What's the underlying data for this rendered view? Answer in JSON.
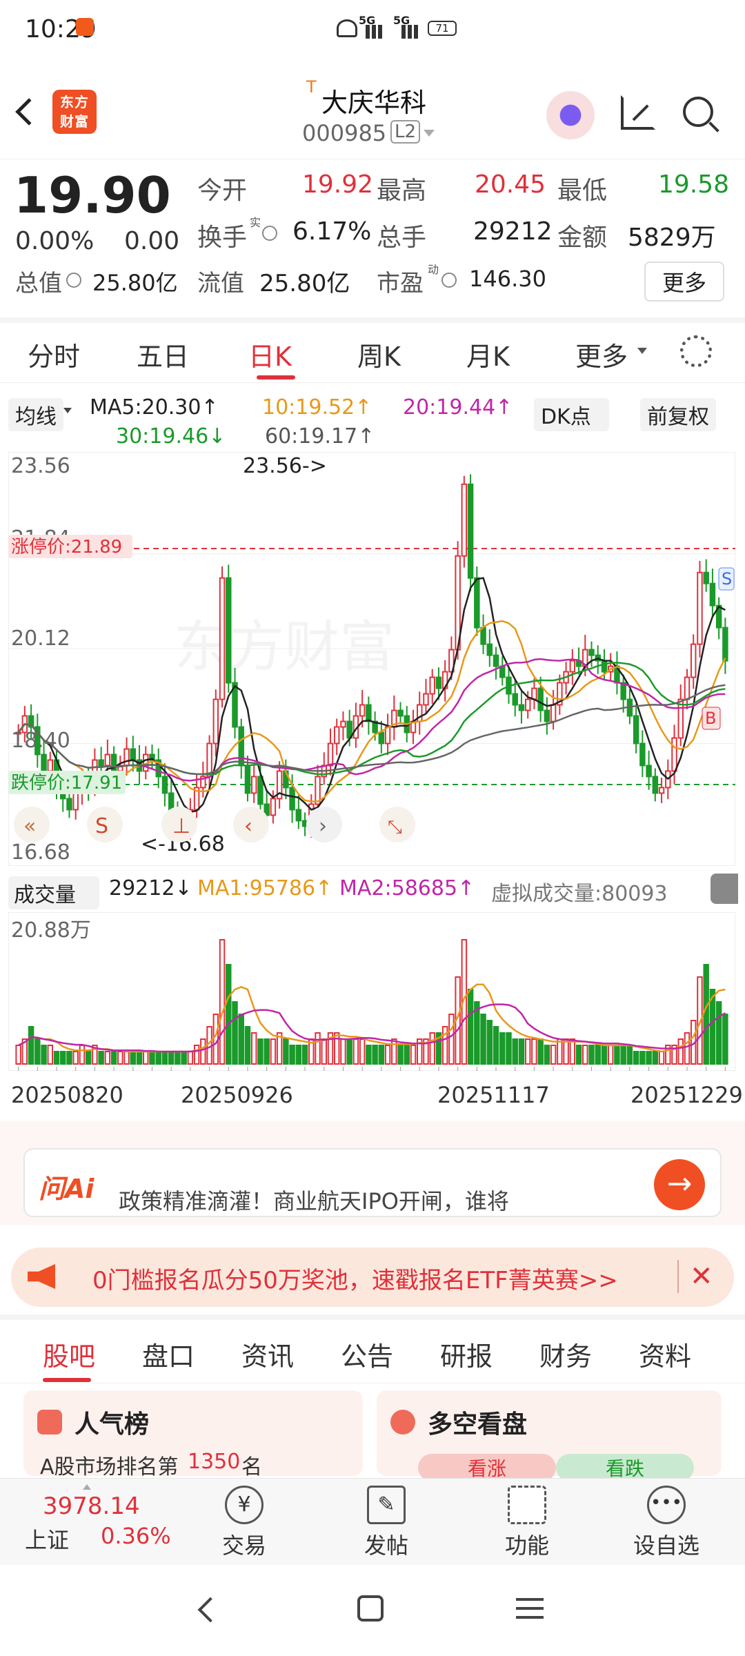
{
  "status": {
    "time": "10:29",
    "signal1": "5G",
    "signal2": "5G",
    "battery": "71"
  },
  "header": {
    "stock_name": "大庆华科",
    "stock_code": "000985",
    "level": "L2",
    "tag": "T",
    "logo_text": "东方财富"
  },
  "quote": {
    "price": "19.90",
    "change_pct": "0.00%",
    "change": "0.00",
    "open_label": "今开",
    "open": "19.92",
    "high_label": "最高",
    "high": "20.45",
    "low_label": "最低",
    "low": "19.58",
    "turnover_label": "换手",
    "turnover": "6.17%",
    "total_vol_label": "总手",
    "total_vol": "29212",
    "amount_label": "金额",
    "amount": "5829万",
    "mktcap_label": "总值",
    "mktcap": "25.80亿",
    "float_label": "流值",
    "float": "25.80亿",
    "pe_label": "市盈",
    "pe": "146.30",
    "more": "更多",
    "sup_real": "实",
    "sup_dyn": "动"
  },
  "tabs": [
    "分时",
    "五日",
    "日K",
    "周K",
    "月K",
    "更多"
  ],
  "ma": {
    "selector": "均线",
    "ma5": "MA5:20.30↑",
    "ma10": "10:19.52↑",
    "ma20": "20:19.44↑",
    "ma30": "30:19.46↓",
    "ma60": "60:19.17↑",
    "dk": "DK点",
    "fq": "前复权"
  },
  "kchart": {
    "y_top": "23.56",
    "y_2": "21.84",
    "y_3": "20.12",
    "y_4": "18.40",
    "y_bottom": "16.68",
    "limit_up": "涨停价:21.89",
    "limit_down": "跌停价:17.91",
    "max_label": "23.56->",
    "min_label": "<-16.68",
    "watermark": "东方财富",
    "s_marker": "S",
    "b_marker": "B"
  },
  "volume": {
    "selector": "成交量",
    "vol": "29212↓",
    "ma1": "MA1:95786↑",
    "ma2": "MA2:58685↑",
    "virtual": "虚拟成交量:80093",
    "y_top": "20.88万"
  },
  "dates": [
    "20250820",
    "20250926",
    "20251117",
    "20251229"
  ],
  "ai": {
    "logo": "问Ai",
    "line1": "政策精准滴灌！商业航天IPO开闸，谁将"
  },
  "banner": {
    "text": "0门槛报名瓜分50万奖池，速戳报名ETF菁英赛>>"
  },
  "bottom_tabs": [
    "股吧",
    "盘口",
    "资讯",
    "公告",
    "研报",
    "财务",
    "资料"
  ],
  "cards": {
    "popularity": "人气榜",
    "rank_prefix": "A股市场排名第",
    "rank": "1350",
    "rank_suffix": "名",
    "longshort": "多空看盘",
    "up": "看涨",
    "down": "看跌"
  },
  "bottombar": {
    "index_value": "3978.14",
    "index_name": "上证",
    "index_pct": "0.36%",
    "trade": "交易",
    "post": "发帖",
    "func": "功能",
    "watch": "设自选"
  },
  "chart_data": {
    "type": "candlestick",
    "title": "",
    "ylim": [
      16.68,
      23.56
    ],
    "close": [
      18.6,
      18.9,
      18.7,
      18.2,
      17.9,
      18.1,
      17.6,
      17.4,
      17.2,
      17.5,
      17.8,
      17.6,
      18.1,
      18.0,
      18.2,
      17.9,
      18.0,
      18.3,
      18.1,
      17.9,
      18.2,
      18.1,
      17.8,
      17.5,
      17.2,
      17.0,
      16.9,
      17.2,
      17.6,
      17.8,
      18.4,
      19.2,
      21.4,
      19.5,
      18.7,
      18.0,
      17.5,
      17.8,
      17.3,
      17.1,
      17.4,
      17.9,
      17.6,
      17.2,
      17.0,
      16.9,
      17.3,
      17.8,
      18.0,
      18.4,
      18.7,
      18.8,
      18.5,
      18.9,
      19.1,
      18.8,
      18.6,
      18.4,
      18.7,
      19.0,
      18.9,
      18.6,
      18.8,
      19.1,
      19.3,
      19.6,
      19.4,
      19.7,
      20.1,
      21.8,
      23.1,
      21.4,
      20.5,
      20.2,
      20.0,
      19.8,
      19.6,
      19.3,
      19.1,
      19.0,
      19.2,
      19.4,
      19.0,
      18.8,
      19.1,
      19.5,
      19.7,
      19.9,
      19.8,
      20.1,
      20.0,
      19.9,
      19.7,
      19.8,
      19.5,
      19.2,
      18.9,
      18.4,
      18.0,
      17.8,
      17.5,
      17.6,
      17.9,
      18.5,
      19.2,
      19.6,
      20.2,
      21.5,
      21.3,
      20.9,
      20.5,
      19.9
    ],
    "volume": [
      3,
      4,
      6,
      4,
      3,
      3,
      2,
      2,
      2,
      2,
      3,
      2,
      3,
      2,
      2,
      2,
      2,
      2,
      2,
      2,
      2,
      2,
      2,
      2,
      2,
      2,
      2,
      2,
      3,
      4,
      6,
      8,
      20,
      16,
      10,
      8,
      6,
      5,
      4,
      4,
      4,
      5,
      4,
      3,
      3,
      3,
      4,
      5,
      4,
      5,
      5,
      4,
      4,
      4,
      4,
      3,
      3,
      3,
      3,
      4,
      3,
      3,
      3,
      4,
      4,
      5,
      5,
      6,
      8,
      14,
      20,
      12,
      10,
      8,
      7,
      6,
      5,
      5,
      4,
      4,
      4,
      4,
      4,
      3,
      3,
      4,
      4,
      4,
      3,
      3,
      3,
      3,
      3,
      3,
      3,
      3,
      3,
      2,
      2,
      2,
      2,
      2,
      3,
      3,
      4,
      5,
      7,
      14,
      16,
      12,
      10,
      8
    ],
    "series": [
      {
        "name": "MA5"
      },
      {
        "name": "MA10"
      },
      {
        "name": "MA20"
      },
      {
        "name": "MA30"
      },
      {
        "name": "MA60"
      }
    ],
    "x_ticks": [
      "20250820",
      "20250926",
      "20251117",
      "20251229"
    ]
  }
}
